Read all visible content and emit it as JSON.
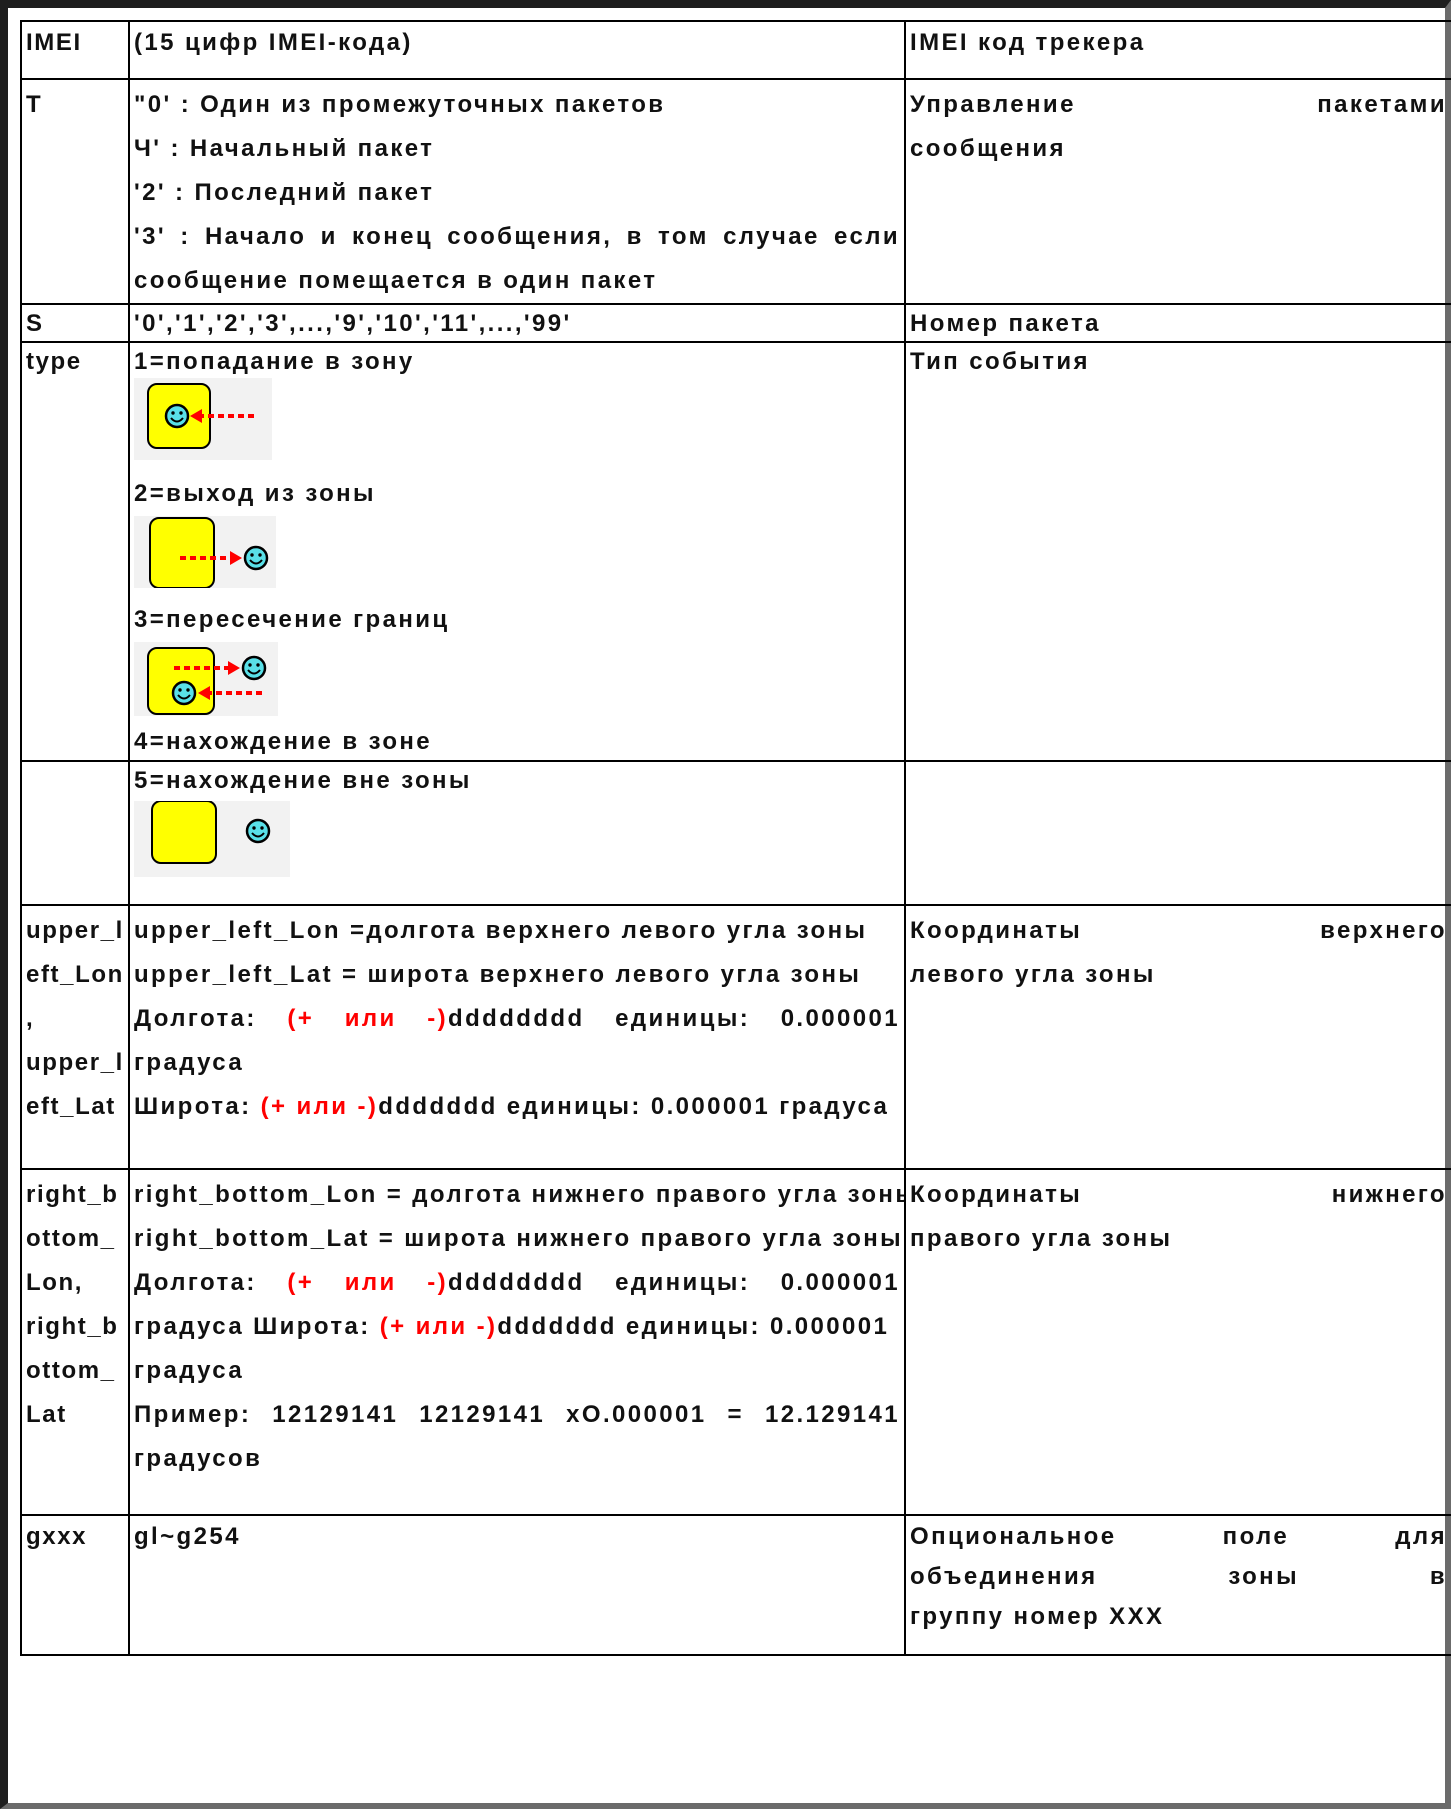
{
  "colors": {
    "text": "#111111",
    "highlight": "#ff0000",
    "zone_fill": "#ffff00",
    "face_fill": "#59e0e8",
    "arrow": "#ff0000",
    "illustration_bg": "#f2f2f2"
  },
  "rows": [
    {
      "field": "IMEI",
      "values": [
        "(15 цифр IMEI-кода)"
      ],
      "description": "IMEI код трекера"
    },
    {
      "field": "T",
      "values": [
        "\"0' : Один из промежуточных пакетов",
        "Ч' : Начальный пакет",
        "'2' : Последний пакет",
        "'3' : Начало и конец сообщения, в том случае если",
        "сообщение помещается в один пакет"
      ],
      "description": [
        "Управление пакетами",
        "сообщения"
      ]
    },
    {
      "field": "S",
      "values": [
        "'0','1','2','3',...,'9','10','11',...,'99'"
      ],
      "description": "Номер пакета"
    },
    {
      "field": "type",
      "events": [
        {
          "label": "1=попадание в зону",
          "icon": "enter-zone-icon"
        },
        {
          "label": "2=выход из зоны",
          "icon": "exit-zone-icon"
        },
        {
          "label": "3=пересечение границ",
          "icon": "cross-border-icon"
        },
        {
          "label": "4=нахождение в зоне"
        }
      ],
      "description": "Тип события"
    },
    {
      "field": "",
      "events": [
        {
          "label": "5=нахождение вне зоны",
          "icon": "outside-zone-icon"
        }
      ],
      "description": ""
    },
    {
      "field": [
        "upper_l",
        "eft_Lon",
        ",",
        "upper_l",
        "eft_Lat"
      ],
      "lines": {
        "l1": "upper_left_Lon =долгота верхнего левого угла зоны",
        "l2": "upper_left_Lat = широта верхнего левого угла зоны",
        "l3a": "Долгота:",
        "l3b": "(+ или -)",
        "l3c": "dddddddd единицы: 0.000001",
        "l4": "градуса",
        "l5a": "Широта:",
        "l5b": "(+ или -)",
        "l5c": "ddddddd единицы: 0.000001 градуса"
      },
      "description": [
        "Координаты верхнего",
        "левого угла зоны"
      ]
    },
    {
      "field": [
        "right_b",
        "ottom_",
        "Lon,",
        "right_b",
        "ottom_",
        "Lat"
      ],
      "lines": {
        "l1": "right_bottom_Lon = долгота нижнего правого угла зоны",
        "l2": "right_bottom_Lat = широта нижнего правого угла зоны",
        "l3a": "Долгота:",
        "l3b": "(+ или -)",
        "l3c": "dddddddd единицы: 0.000001",
        "l4a": "градуса Широта:",
        "l4b": "(+ или -)",
        "l4c": "ddddddd единицы: 0.000001",
        "l5": "градуса",
        "l6": "Пример: 12129141 12129141 xO.000001 = 12.129141",
        "l7": "градусов"
      },
      "description": [
        "Координаты нижнего",
        "правого угла зоны"
      ]
    },
    {
      "field": "gxxx",
      "values": [
        "gl~g254"
      ],
      "description": [
        "Опциональное поле для",
        "объединения зоны в",
        "группу номер XXX"
      ]
    }
  ]
}
